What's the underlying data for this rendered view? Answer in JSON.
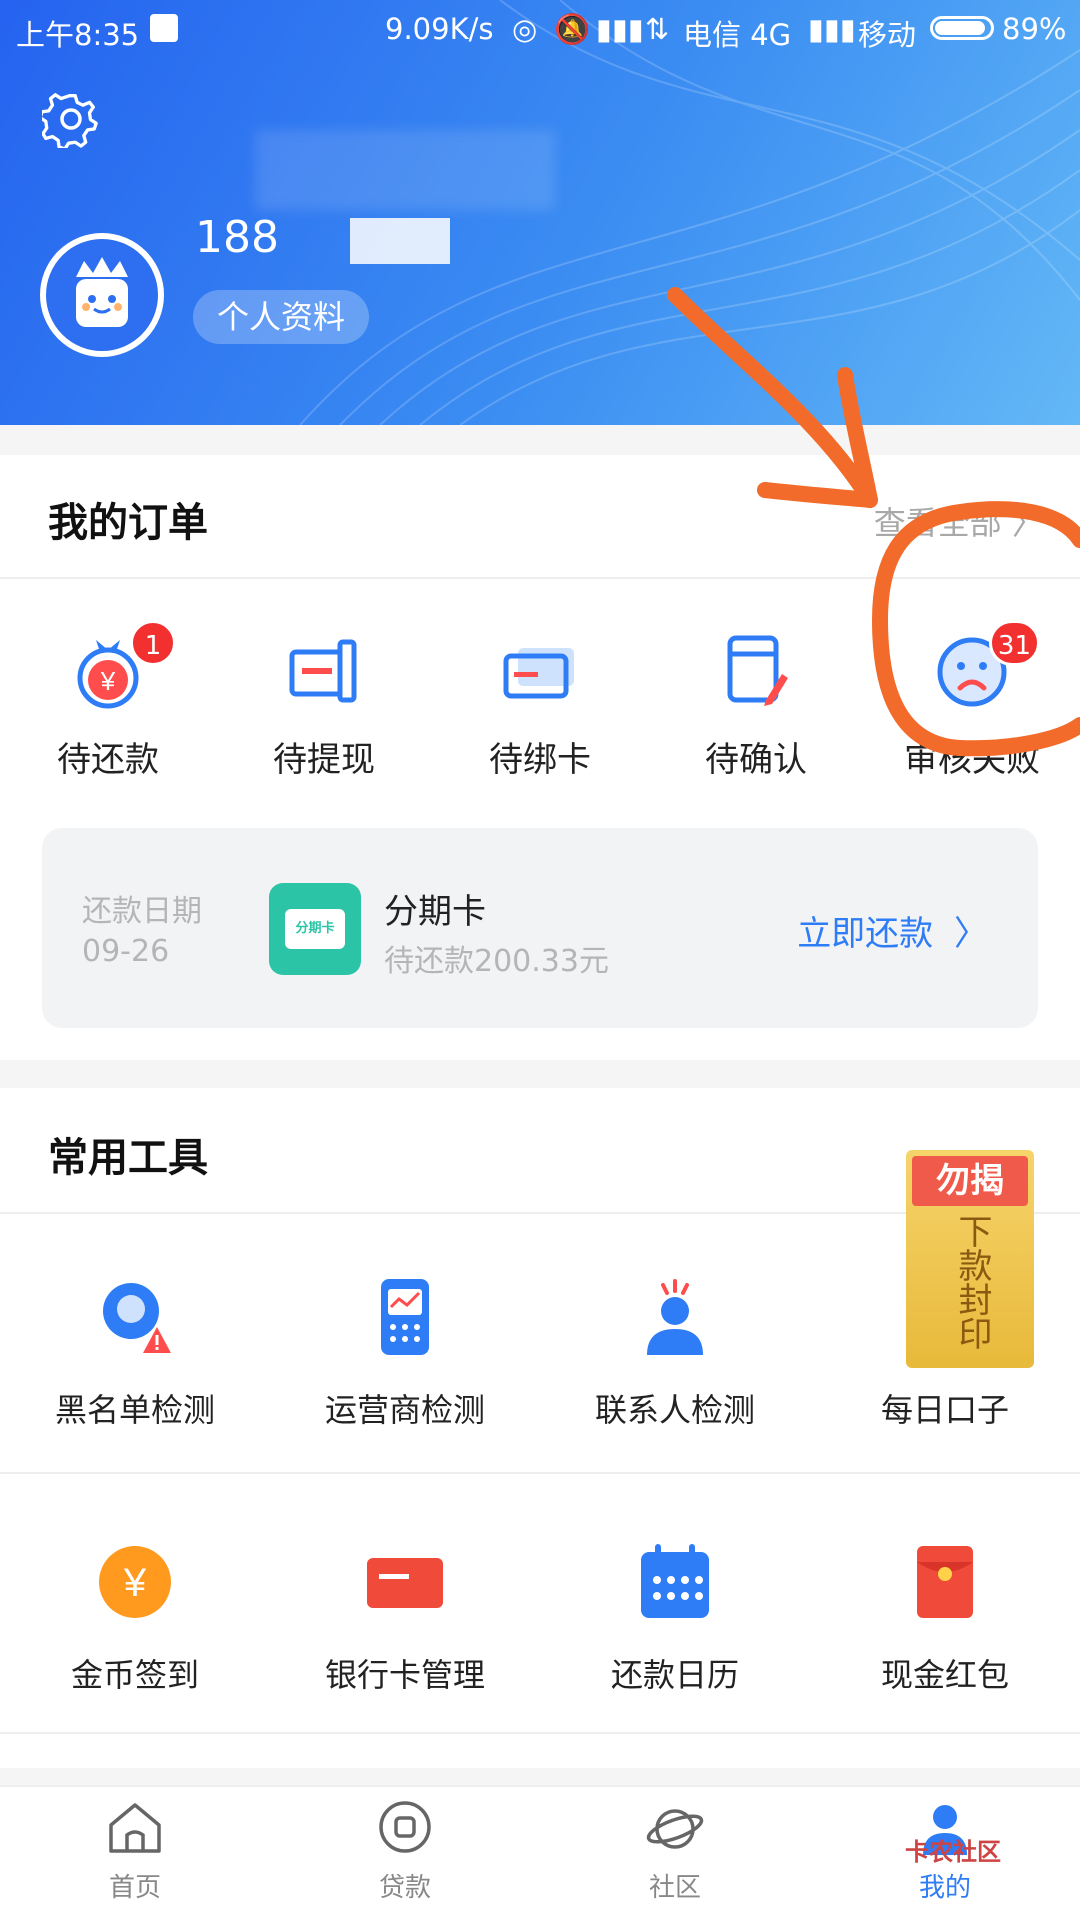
{
  "status_bar": {
    "time": "上午8:35",
    "speed": "9.09K/s",
    "carrier1": "电信 4G",
    "carrier2": "移动",
    "battery": "89%"
  },
  "header": {
    "phone": "188",
    "profile_button": "个人资料"
  },
  "orders": {
    "title": "我的订单",
    "view_all": "查看全部",
    "items": [
      {
        "label": "待还款",
        "badge": "1"
      },
      {
        "label": "待提现",
        "badge": ""
      },
      {
        "label": "待绑卡",
        "badge": ""
      },
      {
        "label": "待确认",
        "badge": ""
      },
      {
        "label": "审核失败",
        "badge": "31"
      }
    ],
    "repay": {
      "date_label": "还款日期",
      "date_value": "09-26",
      "product_name": "分期卡",
      "product_logo_text": "分期卡",
      "amount_text": "待还款200.33元",
      "action": "立即还款"
    }
  },
  "tools": {
    "title": "常用工具",
    "row1": [
      {
        "label": "黑名单检测"
      },
      {
        "label": "运营商检测"
      },
      {
        "label": "联系人检测"
      },
      {
        "label": "每日口子"
      }
    ],
    "row2": [
      {
        "label": "金币签到"
      },
      {
        "label": "银行卡管理"
      },
      {
        "label": "还款日历"
      },
      {
        "label": "现金红包"
      }
    ],
    "seal": {
      "top": "勿揭",
      "body": "下款封印"
    }
  },
  "tabbar": {
    "items": [
      {
        "label": "首页"
      },
      {
        "label": "贷款"
      },
      {
        "label": "社区"
      },
      {
        "label": "我的"
      }
    ]
  },
  "watermark": "卡农社区",
  "colors": {
    "accent": "#2f7df6",
    "badge": "#f23030",
    "annotation": "#f26b2a"
  }
}
